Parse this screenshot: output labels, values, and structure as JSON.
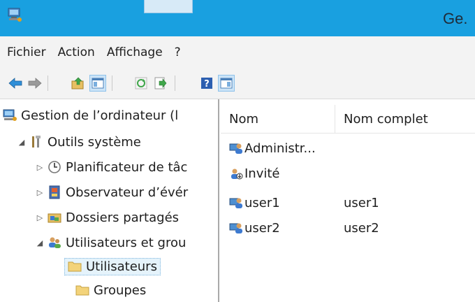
{
  "window": {
    "title_partial": "Ge."
  },
  "menu": [
    "Fichier",
    "Action",
    "Affichage",
    "?"
  ],
  "toolbar": [
    {
      "icon": "back-arrow-icon",
      "color": "#2f8fd8"
    },
    {
      "icon": "forward-arrow-icon",
      "color": "#9a9a9a"
    },
    {
      "icon": "up-folder-icon",
      "color": "#d8a63a"
    },
    {
      "icon": "show-hide-tree-icon",
      "color": "#4a7fb8"
    },
    {
      "icon": "refresh-icon",
      "color": "#3fa64a"
    },
    {
      "icon": "export-list-icon",
      "color": "#3fa64a"
    },
    {
      "icon": "help-icon",
      "color": "#2d5fb0"
    },
    {
      "icon": "action-pane-icon",
      "color": "#4a7fb8"
    }
  ],
  "tree": [
    {
      "label": "Gestion de l’ordinateur (l",
      "icon": "computer-icon",
      "level": 0,
      "expander": ""
    },
    {
      "label": "Outils système",
      "icon": "tools-icon",
      "level": 1,
      "expander": "◢"
    },
    {
      "label": "Planificateur de tâc",
      "icon": "clock-icon",
      "level": 2,
      "expander": "▷"
    },
    {
      "label": "Observateur d’évér",
      "icon": "event-viewer-icon",
      "level": 2,
      "expander": "▷"
    },
    {
      "label": "Dossiers partagés",
      "icon": "shared-folder-icon",
      "level": 2,
      "expander": "▷"
    },
    {
      "label": "Utilisateurs et grou",
      "icon": "users-icon",
      "level": 2,
      "expander": "◢"
    },
    {
      "label": "Utilisateurs",
      "icon": "folder-icon",
      "level": 3,
      "expander": "",
      "selected": true
    },
    {
      "label": "Groupes",
      "icon": "folder-icon",
      "level": 3,
      "expander": ""
    }
  ],
  "columns": [
    "Nom",
    "Nom complet"
  ],
  "users": [
    {
      "name": "Administr...",
      "full_name": "",
      "icon": "user-icon"
    },
    {
      "name": "Invité",
      "full_name": "",
      "icon": "user-disabled-icon"
    },
    {
      "name": "user1",
      "full_name": "user1",
      "icon": "user-icon"
    },
    {
      "name": "user2",
      "full_name": "user2",
      "icon": "user-icon"
    }
  ],
  "colors": {
    "titlebar": "#19a0e0",
    "menubar": "#f3f3f3",
    "selection": "#e5f3fb"
  }
}
